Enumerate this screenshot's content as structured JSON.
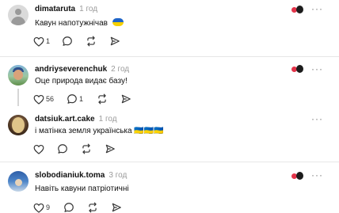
{
  "posts": [
    {
      "username": "dimataruta",
      "time": "1 год",
      "text": "Кавун напотужнічав",
      "flag_emoji": "🇺🇦",
      "likes": "1",
      "replies": "",
      "has_liked_by": true,
      "avatar": "default-avatar"
    },
    {
      "username": "andriyseverenchuk",
      "time": "2 год",
      "text": "Оце природа видає базу!",
      "likes": "56",
      "replies": "1",
      "has_liked_by": true,
      "avatar": "photo"
    },
    {
      "username": "datsiuk.art.cake",
      "time": "1 год",
      "text": "і матінка земля українська 🇺🇦🇺🇦🇺🇦",
      "likes": "",
      "replies": "",
      "has_liked_by": false,
      "avatar": "photo"
    },
    {
      "username": "slobodianiuk.toma",
      "time": "3 год",
      "text": "Навіть кавуни патріотичні",
      "likes": "9",
      "replies": "",
      "has_liked_by": true,
      "avatar": "photo"
    }
  ],
  "more_label": "···",
  "icons": {
    "like": "heart-icon",
    "reply": "comment-icon",
    "repost": "repost-icon",
    "share": "send-icon"
  },
  "colors": {
    "username": "#101010",
    "time": "#9a9a9a",
    "divider": "#e7e7e7"
  }
}
